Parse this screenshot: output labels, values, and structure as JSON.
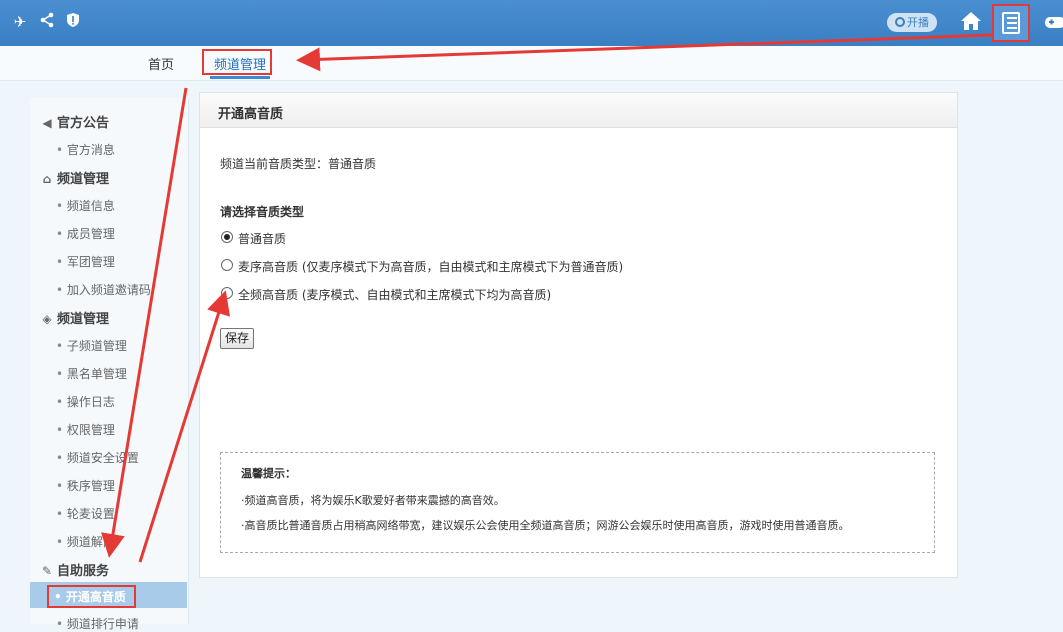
{
  "topbar": {
    "left_icons": [
      "plane-icon",
      "share-icon",
      "shield-icon"
    ],
    "kaibo_label": "开播",
    "right_icons": [
      "home-icon",
      "list-icon",
      "gamepad-icon"
    ]
  },
  "nav": {
    "tabs": [
      {
        "label": "首页",
        "active": false
      },
      {
        "label": "频道管理",
        "active": true
      }
    ]
  },
  "sidebar": {
    "sections": [
      {
        "title": "官方公告",
        "icon": "speaker-icon",
        "items": [
          "官方消息"
        ]
      },
      {
        "title": "频道管理",
        "icon": "home-icon",
        "items": [
          "频道信息",
          "成员管理",
          "军团管理",
          "加入频道邀请码"
        ]
      },
      {
        "title": "频道管理",
        "icon": "shield-icon",
        "items": [
          "子频道管理",
          "黑名单管理",
          "操作日志",
          "权限管理",
          "频道安全设置",
          "秩序管理",
          "轮麦设置",
          "频道解散"
        ]
      },
      {
        "title": "自助服务",
        "icon": "wrench-icon",
        "items": [
          "开通高音质",
          "频道排行申请"
        ]
      }
    ],
    "active_item": "开通高音质"
  },
  "panel": {
    "title": "开通高音质",
    "current_type_label": "频道当前音质类型：",
    "current_type_value": "普通音质",
    "choose_label": "请选择音质类型",
    "options": [
      {
        "label": "普通音质",
        "selected": true
      },
      {
        "label": "麦序高音质 (仅麦序模式下为高音质，自由模式和主席模式下为普通音质)",
        "selected": false
      },
      {
        "label": "全频高音质 (麦序模式、自由模式和主席模式下均为高音质)",
        "selected": false
      }
    ],
    "save_label": "保存",
    "tips": {
      "title": "温馨提示：",
      "lines": [
        "·频道高音质，将为娱乐K歌爱好者带来震撼的高音效。",
        "·高音质比普通音质占用稍高网络带宽，建议娱乐公会使用全频道高音质；网游公会娱乐时使用高音质，游戏时使用普通音质。"
      ]
    }
  },
  "colors": {
    "topbar": "#3a7fc3",
    "accent": "#1e6fbf",
    "annotation_red": "#e53935",
    "sidebar_active": "#a7cbe8"
  }
}
